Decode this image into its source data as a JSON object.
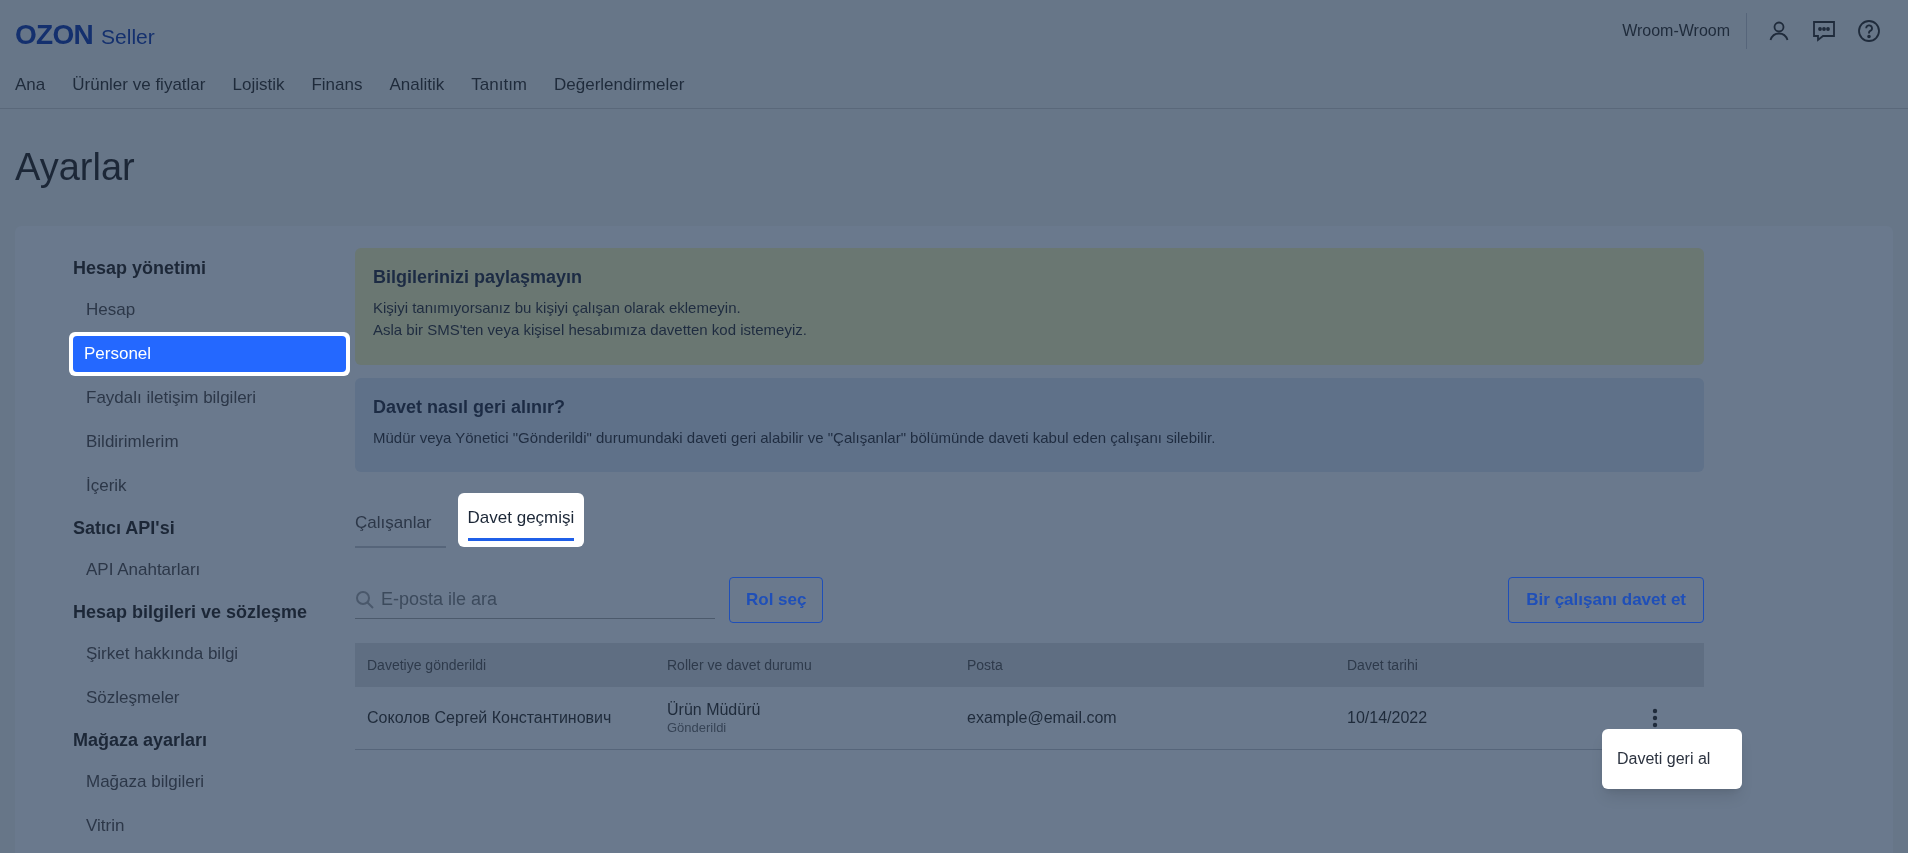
{
  "header": {
    "logo": "OZON",
    "logo_suffix": "Seller",
    "account": "Wroom-Wroom"
  },
  "nav": [
    "Ana",
    "Ürünler ve fiyatlar",
    "Lojistik",
    "Finans",
    "Analitik",
    "Tanıtım",
    "Değerlendirmeler"
  ],
  "page_title": "Ayarlar",
  "sidebar": [
    {
      "heading": "Hesap yönetimi",
      "items": [
        {
          "label": "Hesap",
          "selected": false
        },
        {
          "label": "Personel",
          "selected": true
        },
        {
          "label": "Faydalı iletişim bilgileri",
          "selected": false
        },
        {
          "label": "Bildirimlerim",
          "selected": false
        },
        {
          "label": "İçerik",
          "selected": false
        }
      ]
    },
    {
      "heading": "Satıcı API'si",
      "items": [
        {
          "label": "API Anahtarları",
          "selected": false
        }
      ]
    },
    {
      "heading": "Hesap bilgileri ve sözleşme",
      "items": [
        {
          "label": "Şirket hakkında bilgi",
          "selected": false
        },
        {
          "label": "Sözleşmeler",
          "selected": false
        }
      ]
    },
    {
      "heading": "Mağaza ayarları",
      "items": [
        {
          "label": "Mağaza bilgileri",
          "selected": false
        },
        {
          "label": "Vitrin",
          "selected": false
        }
      ]
    }
  ],
  "alerts": [
    {
      "kind": "warning",
      "title": "Bilgilerinizi paylaşmayın",
      "lines": [
        "Kişiyi tanımıyorsanız bu kişiyi çalışan olarak eklemeyin.",
        "Asla bir SMS'ten veya kişisel hesabımıza davetten kod istemeyiz."
      ]
    },
    {
      "kind": "info",
      "title": "Davet nasıl geri alınır?",
      "lines": [
        "Müdür veya Yönetici \"Gönderildi\" durumundaki daveti geri alabilir ve \"Çalışanlar\" bölümünde daveti kabul eden çalışanı silebilir."
      ]
    }
  ],
  "tabs": [
    {
      "label": "Çalışanlar",
      "selected": false
    },
    {
      "label": "Davet geçmişi",
      "selected": true
    }
  ],
  "search": {
    "placeholder": "E-posta ile ara"
  },
  "role_button": "Rol seç",
  "invite_button": "Bir çalışanı davet et",
  "table": {
    "columns": [
      "Davetiye gönderildi",
      "Roller ve davet durumu",
      "Posta",
      "Davet tarihi"
    ],
    "rows": [
      {
        "name": "Соколов Сергей Константинович",
        "role": "Ürün Müdürü",
        "status": "Gönderildi",
        "email": "example@email.com",
        "date": "10/14/2022"
      }
    ]
  },
  "row_menu": {
    "items": [
      "Daveti geri al"
    ]
  }
}
